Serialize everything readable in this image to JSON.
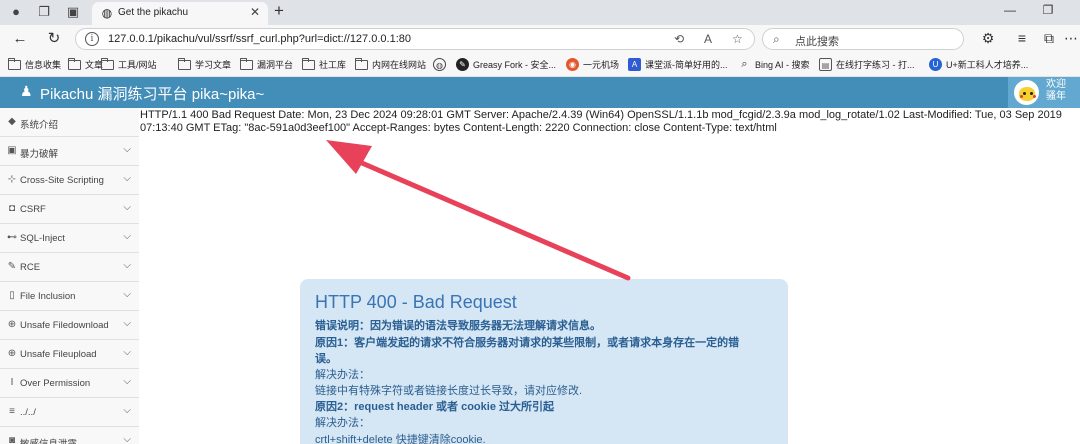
{
  "browser": {
    "tab_title": "Get the pikachu",
    "url": "127.0.0.1/pikachu/vul/ssrf/ssrf_curl.php?url=dict://127.0.0.1:80",
    "search_placeholder": "点此搜索",
    "bookmarks": [
      {
        "label": "信息收集",
        "type": "folder"
      },
      {
        "label": "文章",
        "type": "folder"
      },
      {
        "label": "工具/网站",
        "type": "folder"
      },
      {
        "label": "学习文章",
        "type": "folder"
      },
      {
        "label": "漏洞平台",
        "type": "folder"
      },
      {
        "label": "社工库",
        "type": "folder"
      },
      {
        "label": "内网在线网站",
        "type": "folder"
      },
      {
        "label": "",
        "type": "globe"
      },
      {
        "label": "Greasy Fork - 安全...",
        "type": "site"
      },
      {
        "label": "一元机场",
        "type": "site"
      },
      {
        "label": "课堂派-简单好用的...",
        "type": "site"
      },
      {
        "label": "Bing AI - 搜索",
        "type": "site"
      },
      {
        "label": "在线打字练习 - 打...",
        "type": "site"
      },
      {
        "label": "U+新工科人才培养...",
        "type": "site"
      }
    ]
  },
  "app": {
    "brand": "Pikachu 漏洞练习平台 pika~pika~",
    "welcome_line1": "欢迎",
    "welcome_line2": "骚年"
  },
  "sidebar": {
    "items": [
      {
        "label": "系统介绍",
        "icon": "tag-icon",
        "expandable": false
      },
      {
        "label": "暴力破解",
        "icon": "lock-icon",
        "expandable": true
      },
      {
        "label": "Cross-Site Scripting",
        "icon": "xss-icon",
        "expandable": true
      },
      {
        "label": "CSRF",
        "icon": "csrf-icon",
        "expandable": true
      },
      {
        "label": "SQL-Inject",
        "icon": "sql-icon",
        "expandable": true
      },
      {
        "label": "RCE",
        "icon": "pencil-icon",
        "expandable": true
      },
      {
        "label": "File Inclusion",
        "icon": "file-icon",
        "expandable": true
      },
      {
        "label": "Unsafe Filedownload",
        "icon": "download-icon",
        "expandable": true
      },
      {
        "label": "Unsafe Fileupload",
        "icon": "upload-icon",
        "expandable": true
      },
      {
        "label": "Over Permission",
        "icon": "text-cursor-icon",
        "expandable": true
      },
      {
        "label": "../../",
        "icon": "list-icon",
        "expandable": true
      },
      {
        "label": "敏感信息泄露",
        "icon": "camera-icon",
        "expandable": true
      }
    ]
  },
  "main": {
    "response_text": "HTTP/1.1 400 Bad Request Date: Mon, 23 Dec 2024 09:28:01 GMT Server: Apache/2.4.39 (Win64) OpenSSL/1.1.1b mod_fcgid/2.3.9a mod_log_rotate/1.02 Last-Modified: Tue, 03 Sep 2019 07:13:40 GMT ETag: \"8ac-591a0d3eef100\" Accept-Ranges: bytes Content-Length: 2220 Connection: close Content-Type: text/html",
    "error": {
      "heading": "HTTP 400 - Bad Request",
      "desc_label": "错误说明：因为错误的语法导致服务器无法理解请求信息。",
      "reason1_a": "原因1：客户端发起的请求不符合服务器对请求的某些限制，或者请求本身存在一定的错",
      "reason1_b": "误。",
      "solution_label_1": "解决办法：",
      "solution_1": "链接中有特殊字符或者链接长度过长导致，请对应修改.",
      "reason2": "原因2：request header 或者 cookie 过大所引起",
      "solution_label_2": "解决办法：",
      "solution_2": "crtl+shift+delete 快捷键清除cookie."
    }
  },
  "colors": {
    "header_blue": "#438eb9",
    "arrow_red": "#e8425a",
    "error_bg": "#d5e6f4"
  }
}
